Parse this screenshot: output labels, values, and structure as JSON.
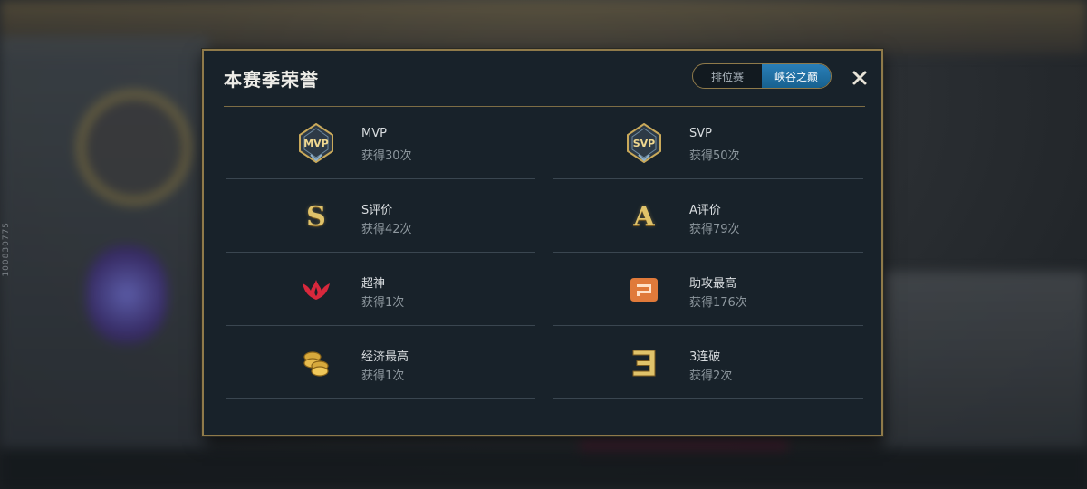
{
  "background": {
    "side_text": "100830775"
  },
  "dialog": {
    "title": "本赛季荣誉",
    "tabs": [
      {
        "label": "排位赛",
        "active": false
      },
      {
        "label": "峡谷之巅",
        "active": true
      }
    ],
    "close_icon": "close-icon",
    "honors": [
      {
        "icon": "mvp-badge-icon",
        "badge_text": "MVP",
        "name": "MVP",
        "count": "获得30次"
      },
      {
        "icon": "svp-badge-icon",
        "badge_text": "SVP",
        "name": "SVP",
        "count": "获得50次"
      },
      {
        "icon": "s-rating-icon",
        "badge_text": "S",
        "name": "S评价",
        "count": "获得42次"
      },
      {
        "icon": "a-rating-icon",
        "badge_text": "A",
        "name": "A评价",
        "count": "获得79次"
      },
      {
        "icon": "legendary-icon",
        "name": "超神",
        "count": "获得1次"
      },
      {
        "icon": "most-assists-icon",
        "name": "助攻最高",
        "count": "获得176次"
      },
      {
        "icon": "coins-icon",
        "name": "经济最高",
        "count": "获得1次"
      },
      {
        "icon": "triple-kill-icon",
        "name": "3连破",
        "count": "获得2次"
      }
    ],
    "colors": {
      "gold_border": "#8f7a4a",
      "panel_bg": "#18222a",
      "tab_active": "#2a7fb8",
      "legendary_red": "#d8283c",
      "assist_orange": "#e07a3a",
      "gold_icon": "#e0c36a"
    }
  }
}
